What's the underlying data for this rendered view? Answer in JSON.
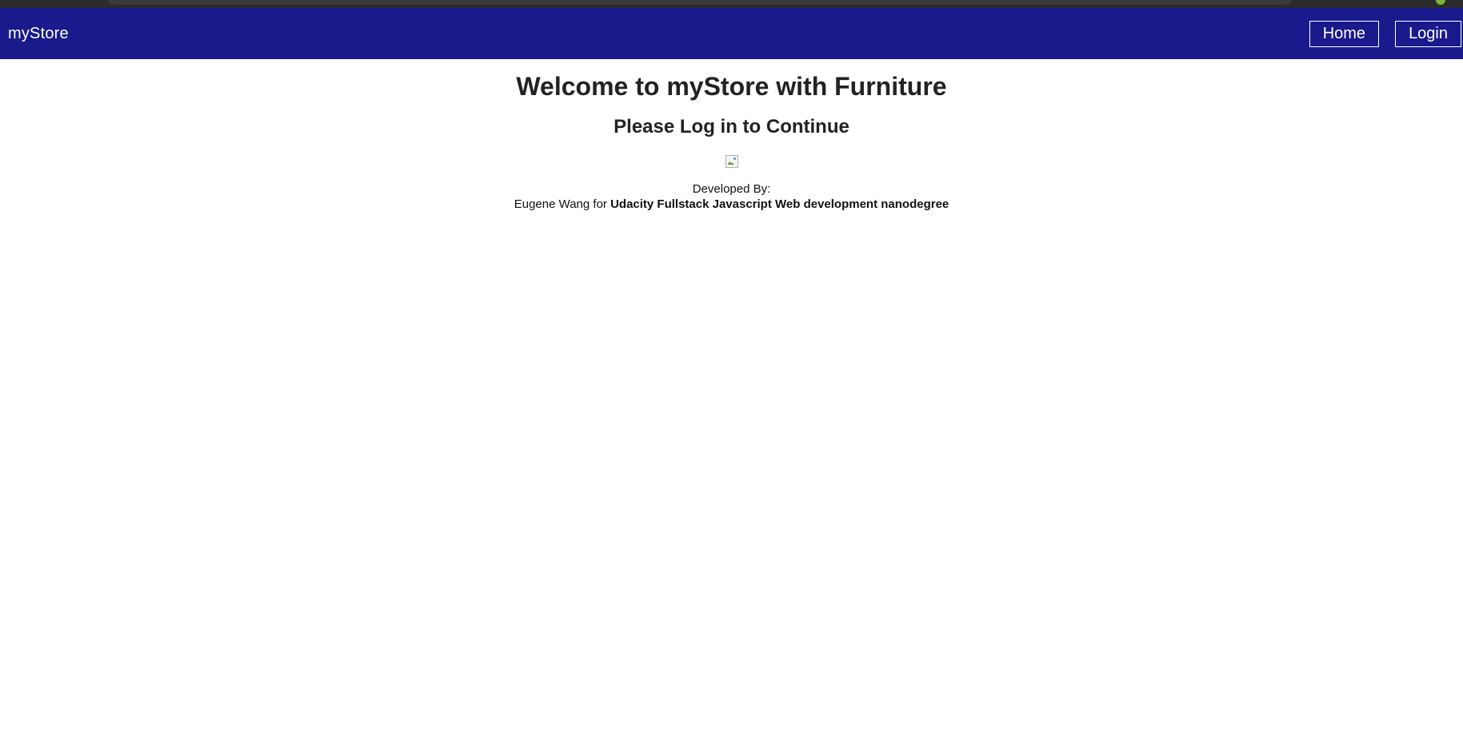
{
  "navbar": {
    "brand": "myStore",
    "home_label": "Home",
    "login_label": "Login",
    "background": "#1a1a8c"
  },
  "main": {
    "title": "Welcome to myStore with Furniture",
    "subtitle": "Please Log in to Continue",
    "hero_image_icon": "broken-image-icon",
    "credits": {
      "line1": "Developed By:",
      "author": "Eugene Wang for",
      "program": "Udacity Fullstack Javascript Web development nanodegree"
    }
  }
}
